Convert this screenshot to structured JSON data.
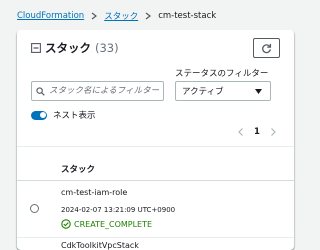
{
  "breadcrumb": {
    "root": "CloudFormation",
    "parent": "スタック",
    "current": "cm-test-stack"
  },
  "panel": {
    "title": "スタック",
    "count": "(33)"
  },
  "filters": {
    "search_placeholder": "スタック名によるフィルター",
    "status_label": "ステータスのフィルター",
    "status_value": "アクティブ"
  },
  "nested_toggle": {
    "label": "ネスト表示",
    "on": true
  },
  "pagination": {
    "current_page": "1"
  },
  "table": {
    "column_header": "スタック",
    "rows": [
      {
        "name": "cm-test-iam-role",
        "time": "2024-02-07 13:21:09 UTC+0900",
        "status": "CREATE_COMPLETE"
      },
      {
        "name": "CdkToolkitVpcStack"
      }
    ]
  },
  "colors": {
    "link": "#0073bb",
    "success": "#1d8102",
    "toggle_on": "#0073bb",
    "text": "#16191f",
    "muted": "#687078"
  },
  "icons": {
    "breadcrumb_separator": "chevron-right-icon",
    "collapse": "collapse-square-icon",
    "refresh": "refresh-icon",
    "search": "search-icon",
    "dropdown": "caret-down-icon",
    "prev_page": "chevron-left-icon",
    "next_page": "chevron-right-icon",
    "status": "check-circle-icon"
  }
}
